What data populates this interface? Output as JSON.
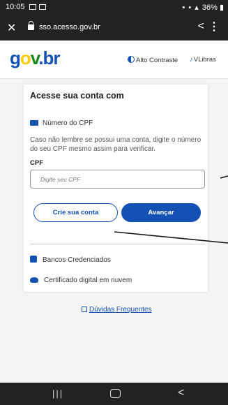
{
  "status_bar": {
    "time": "10:05",
    "right_text": "36%"
  },
  "browser": {
    "url": "sso.acesso.gov.br",
    "close_symbol": "✕",
    "share_symbol": "<",
    "menu_symbol": "⋮"
  },
  "header": {
    "logo": {
      "g": "g",
      "o": "o",
      "v": "v",
      "dot": ".",
      "br": "br"
    },
    "high_contrast": "Alto Contraste",
    "vlibras": "VLibras"
  },
  "login": {
    "title": "Acesse sua conta com",
    "cpf_option": "Número do CPF",
    "help_text": "Caso não lembre se possui uma conta, digite o número do seu CPF mesmo assim para verificar.",
    "cpf_label": "CPF",
    "cpf_placeholder": "Digite seu CPF",
    "cpf_value": "",
    "create_account": "Crie sua conta",
    "next": "Avançar",
    "options": [
      {
        "label": "Bancos Credenciados",
        "icon": "bank-icon"
      },
      {
        "label": "Certificado digital em nuvem",
        "icon": "cloud-icon"
      }
    ]
  },
  "faq": "Dúvidas Frequentes",
  "nav_bar": {
    "recent": "|||",
    "back": "<"
  },
  "colors": {
    "primary": "#1351b4",
    "gov_blue": "#1351b4",
    "gov_yellow": "#ffcd07",
    "gov_green": "#168821",
    "system_bar": "#222222"
  }
}
